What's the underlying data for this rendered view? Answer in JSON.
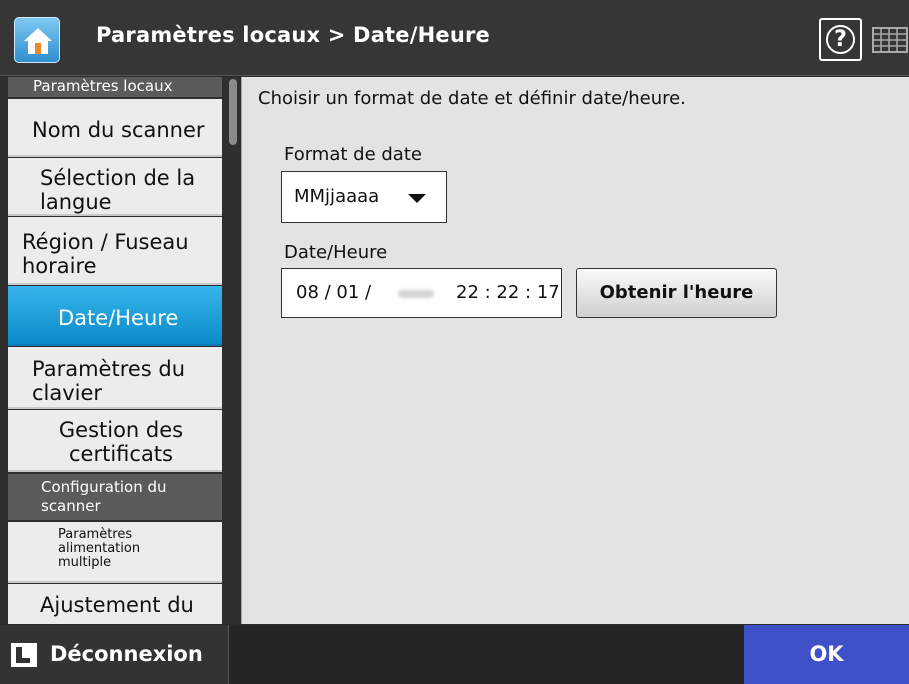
{
  "header": {
    "title": "Paramètres locaux > Date/Heure",
    "help_icon": "?"
  },
  "sidebar": {
    "section_local": "Paramètres locaux",
    "items": [
      {
        "label": "Nom du scanner"
      },
      {
        "label": "Sélection de la langue"
      },
      {
        "label": "Région / Fuseau horaire"
      },
      {
        "label": "Date/Heure",
        "active": true
      },
      {
        "label": "Paramètres du clavier"
      },
      {
        "label": "Gestion des certificats"
      }
    ],
    "section_scanner": "Configuration du scanner",
    "scanner_items": [
      {
        "label": "Paramètres alimentation multiple"
      },
      {
        "label": "Ajustement du"
      }
    ]
  },
  "main": {
    "description": "Choisir un format de date et définir date/heure.",
    "date_format_label": "Format de date",
    "date_format_value": "MMjjaaaa",
    "datetime_label": "Date/Heure",
    "date_part": "08 / 01 /",
    "time_part": "22 : 22 : 17",
    "get_time_button": "Obtenir l'heure"
  },
  "footer": {
    "logout": "Déconnexion",
    "ok": "OK"
  },
  "colors": {
    "accent_blue": "#1a9ad8",
    "ok_blue": "#3f51c8",
    "header_bg": "#363636"
  }
}
